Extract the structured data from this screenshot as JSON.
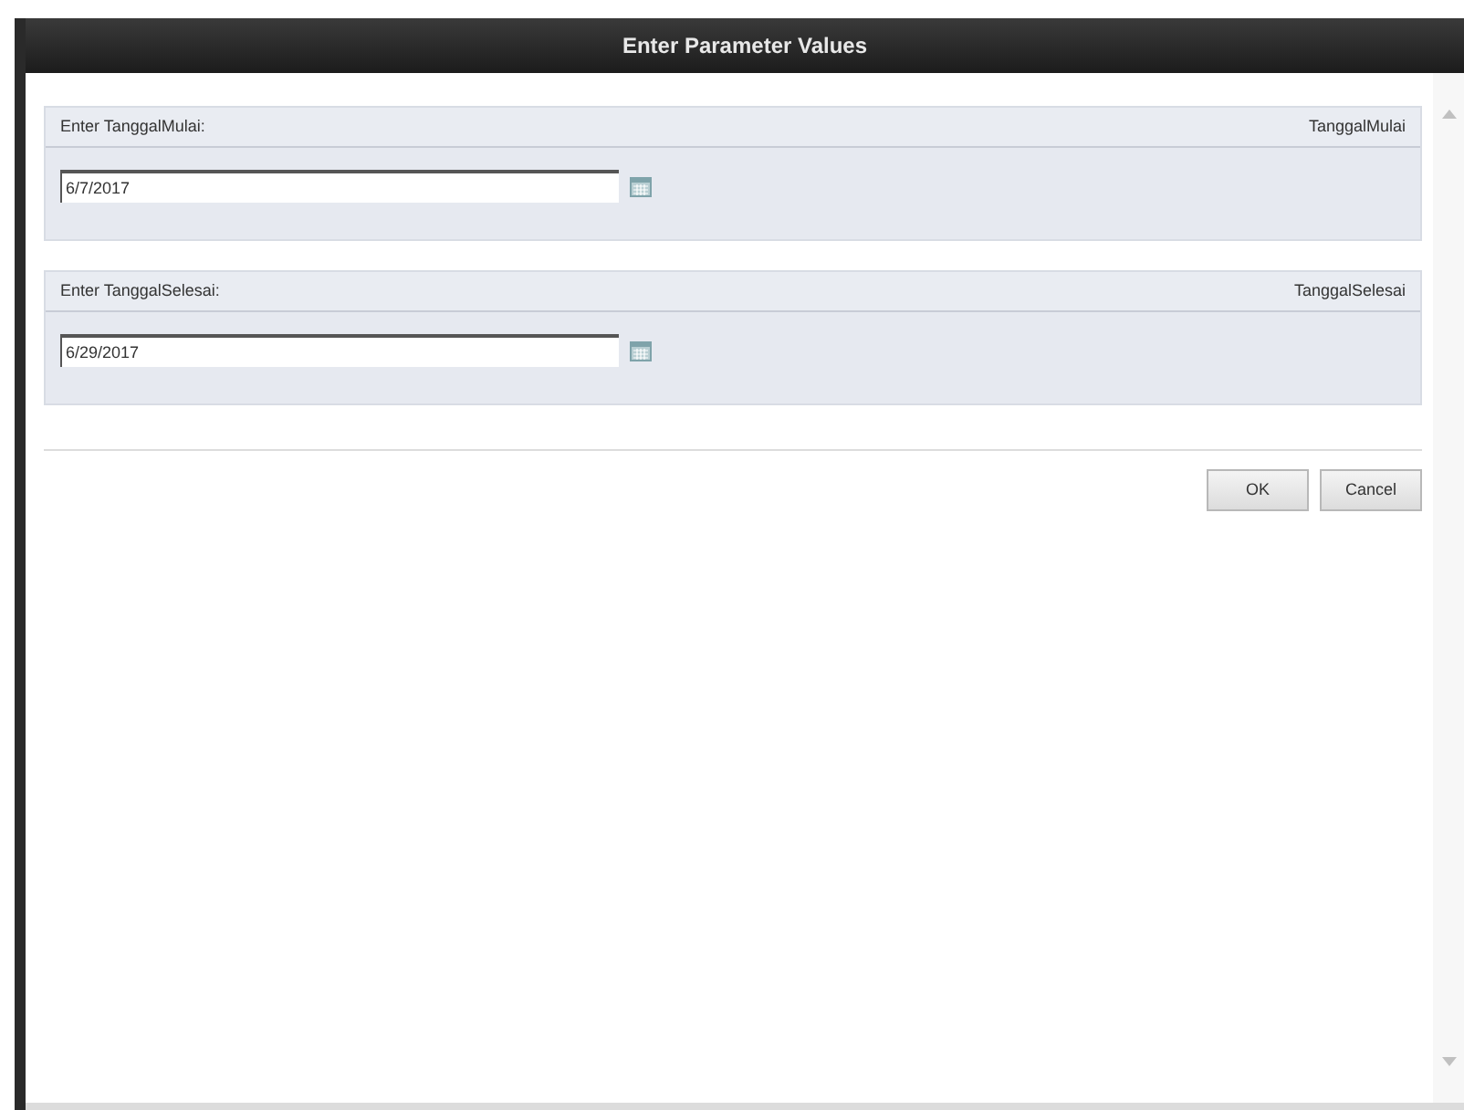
{
  "window": {
    "title": "Enter Parameter Values"
  },
  "parameters": [
    {
      "prompt": "Enter TanggalMulai:",
      "name": "TanggalMulai",
      "value": "6/7/2017"
    },
    {
      "prompt": "Enter TanggalSelesai:",
      "name": "TanggalSelesai",
      "value": "6/29/2017"
    }
  ],
  "buttons": [
    "OK",
    "Cancel"
  ]
}
